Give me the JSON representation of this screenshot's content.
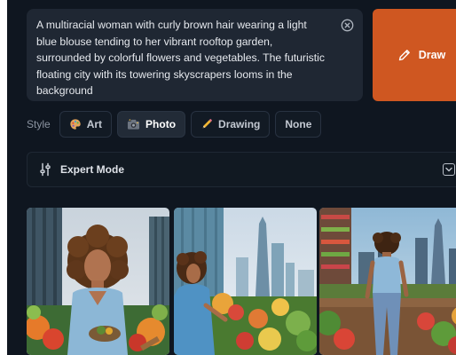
{
  "prompt": {
    "text": "A multiracial woman with curly brown hair wearing a light blue blouse tending to her vibrant rooftop garden, surrounded by colorful flowers and vegetables. The futuristic floating city with its towering skyscrapers looms in the background",
    "clear_icon": "close-circle-icon"
  },
  "draw_button": {
    "label": "Draw",
    "icon": "pencil-icon"
  },
  "style": {
    "label": "Style",
    "options": [
      {
        "label": "Art",
        "icon": "palette-icon",
        "selected": false
      },
      {
        "label": "Photo",
        "icon": "camera-icon",
        "selected": true
      },
      {
        "label": "Drawing",
        "icon": "pencil-icon",
        "selected": false
      },
      {
        "label": "None",
        "icon": "",
        "selected": false
      }
    ]
  },
  "expert_mode": {
    "label": "Expert Mode",
    "icon": "sliders-icon",
    "chevron": "chevron-down-icon"
  },
  "gallery": {
    "images": [
      {
        "kind": "generated-image"
      },
      {
        "kind": "generated-image"
      },
      {
        "kind": "generated-image"
      }
    ]
  },
  "colors": {
    "background": "#0f1620",
    "panel": "#1f2733",
    "accent": "#cf5721",
    "text": "#e6e9ee",
    "muted": "#8a93a0"
  }
}
